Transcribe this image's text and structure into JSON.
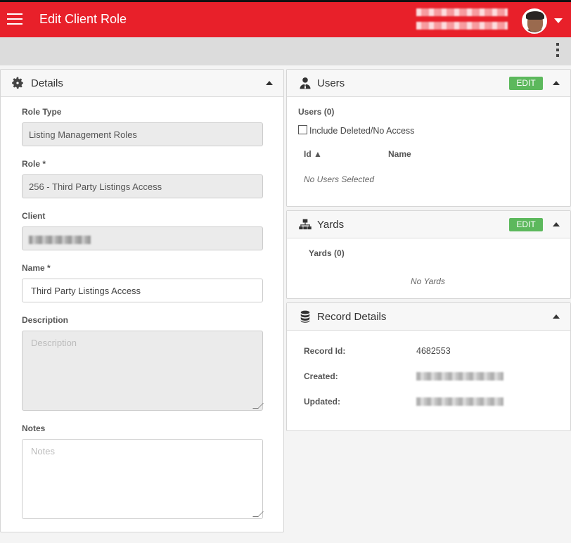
{
  "header": {
    "title": "Edit Client Role",
    "user_name": "",
    "user_org": ""
  },
  "colors": {
    "brand": "#e8202a",
    "edit": "#5cb85c"
  },
  "details": {
    "title": "Details",
    "icon": "gear-icon",
    "role_type_label": "Role Type",
    "role_type_value": "Listing Management Roles",
    "role_label": "Role *",
    "role_value": "256 - Third Party Listings Access",
    "client_label": "Client",
    "client_value": "",
    "name_label": "Name *",
    "name_value": "Third Party Listings Access",
    "description_label": "Description",
    "description_placeholder": "Description",
    "notes_label": "Notes",
    "notes_placeholder": "Notes"
  },
  "users": {
    "title": "Users",
    "icon": "user-tie-icon",
    "edit_label": "EDIT",
    "count_label": "Users (0)",
    "include_label": "Include Deleted/No Access",
    "col_id": "Id ▲",
    "col_name": "Name",
    "empty": "No Users Selected"
  },
  "yards": {
    "title": "Yards",
    "icon": "network-icon",
    "edit_label": "EDIT",
    "count_label": "Yards (0)",
    "empty": "No Yards"
  },
  "record": {
    "title": "Record Details",
    "icon": "database-icon",
    "id_label": "Record Id:",
    "id_value": "4682553",
    "created_label": "Created:",
    "updated_label": "Updated:"
  }
}
